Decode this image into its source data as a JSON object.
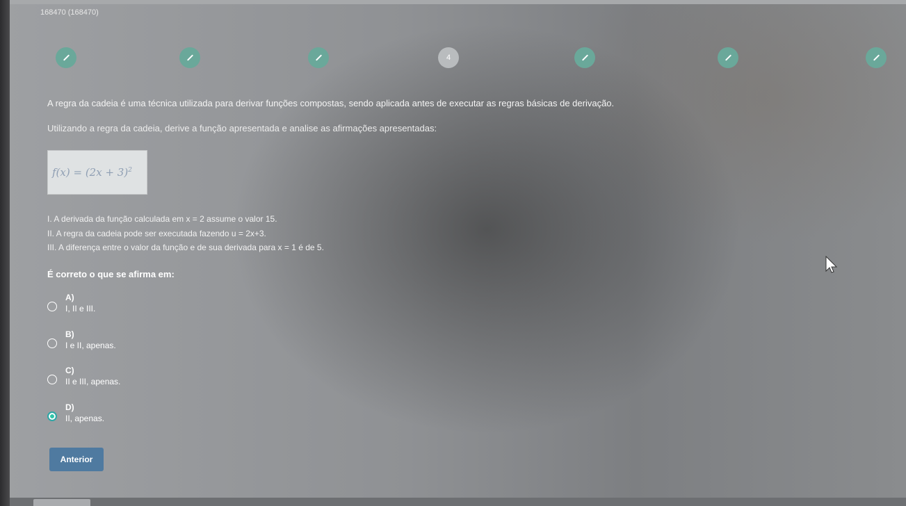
{
  "header": {
    "question_id": "168470 (168470)"
  },
  "progress": {
    "steps": [
      {
        "state": "done",
        "icon": "pencil-icon",
        "label": ""
      },
      {
        "state": "done",
        "icon": "pencil-icon",
        "label": ""
      },
      {
        "state": "done",
        "icon": "pencil-icon",
        "label": ""
      },
      {
        "state": "current",
        "icon": "",
        "label": "4"
      },
      {
        "state": "done",
        "icon": "pencil-icon",
        "label": ""
      },
      {
        "state": "done",
        "icon": "pencil-icon",
        "label": ""
      },
      {
        "state": "done",
        "icon": "pencil-icon",
        "label": ""
      }
    ],
    "colors": {
      "done": "#6aa89a",
      "current": "#b9bcbe"
    }
  },
  "question": {
    "intro": "A regra da cadeia é uma técnica utilizada para derivar funções compostas, sendo aplicada antes de executar as regras básicas de derivação.",
    "instruction": "Utilizando a regra da cadeia, derive a função apresentada e analise as afirmações apresentadas:",
    "formula_lhs": "f(x) = (2x + 3)",
    "formula_exp": "2",
    "statements": [
      "I. A derivada da função calculada em x = 2 assume o valor 15.",
      "II. A regra da cadeia pode ser executada fazendo u = 2x+3.",
      "III. A diferença entre o valor da função e de sua derivada para x = 1 é de 5."
    ],
    "prompt": "É correto o que se afirma em:"
  },
  "options": [
    {
      "letter": "A)",
      "text": "I, II e III.",
      "selected": false
    },
    {
      "letter": "B)",
      "text": "I e II, apenas.",
      "selected": false
    },
    {
      "letter": "C)",
      "text": "II e III, apenas.",
      "selected": false
    },
    {
      "letter": "D)",
      "text": "II, apenas.",
      "selected": true
    }
  ],
  "navigation": {
    "previous_label": "Anterior"
  },
  "colors": {
    "accent_button": "#4f7aa0",
    "selected_radio": "#2fc5a8"
  }
}
